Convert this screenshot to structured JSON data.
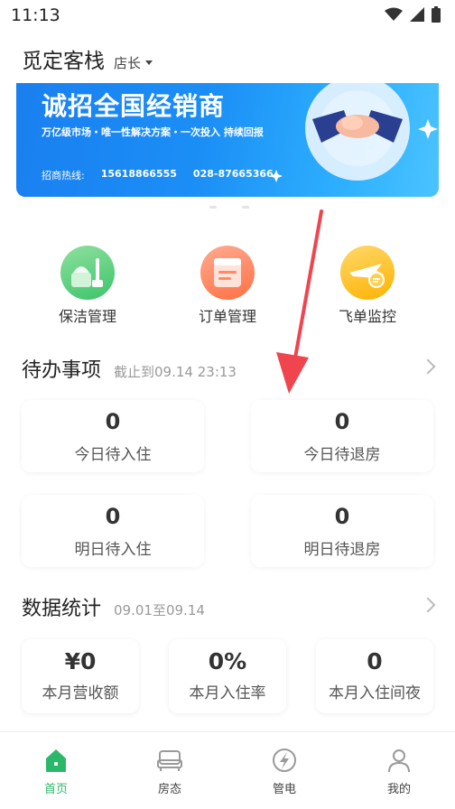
{
  "status_bar": {
    "time": "11:13"
  },
  "header": {
    "shop_name": "觅定客栈",
    "role": "店长"
  },
  "banner": {
    "title": "诚招全国经销商",
    "subtitle": "万亿级市场・唯一性解决方案・一次投入 持续回报",
    "hotline_label": "招商热线:",
    "phone1": "15618866555",
    "phone2": "028-87665366"
  },
  "quick_actions": [
    {
      "label": "保洁管理",
      "icon": "cleaning-icon",
      "color": "#5ccf7e"
    },
    {
      "label": "订单管理",
      "icon": "order-icon",
      "color": "#ff8a65"
    },
    {
      "label": "飞单监控",
      "icon": "plane-icon",
      "color": "#ffc531"
    }
  ],
  "todo": {
    "title": "待办事项",
    "deadline": "截止到09.14 23:13",
    "cards": [
      {
        "value": "0",
        "label": "今日待入住"
      },
      {
        "value": "0",
        "label": "今日待退房"
      },
      {
        "value": "0",
        "label": "明日待入住"
      },
      {
        "value": "0",
        "label": "明日待退房"
      }
    ]
  },
  "stats": {
    "title": "数据统计",
    "range": "09.01至09.14",
    "cards": [
      {
        "value": "¥0",
        "label": "本月营收额"
      },
      {
        "value": "0%",
        "label": "本月入住率"
      },
      {
        "value": "0",
        "label": "本月入住间夜"
      }
    ]
  },
  "tabbar": {
    "active_color": "#2cb86a",
    "items": [
      {
        "label": "首页",
        "icon": "home-icon",
        "active": true
      },
      {
        "label": "房态",
        "icon": "bed-icon",
        "active": false
      },
      {
        "label": "管电",
        "icon": "power-icon",
        "active": false
      },
      {
        "label": "我的",
        "icon": "user-icon",
        "active": false
      }
    ]
  },
  "annotation": {
    "color": "#f0454f"
  }
}
